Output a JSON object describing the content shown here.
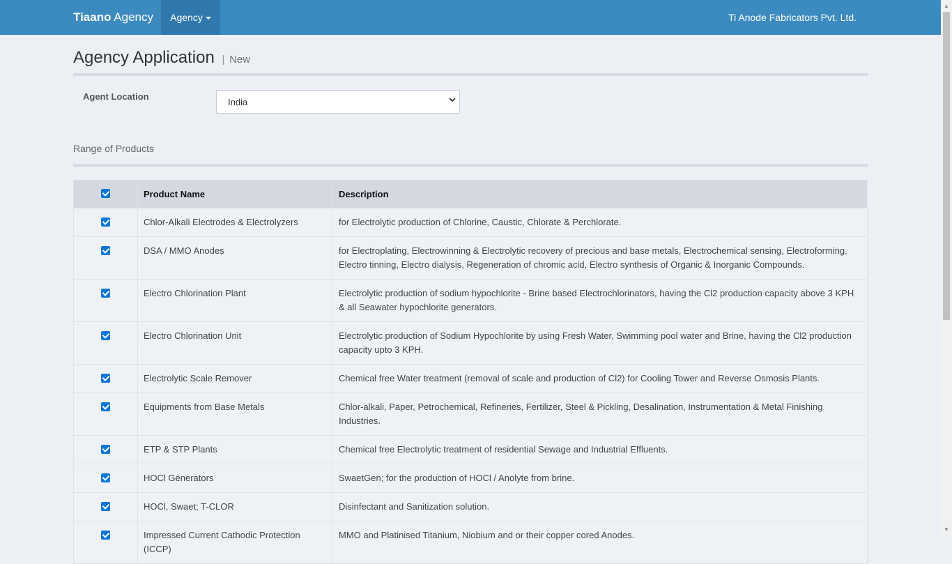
{
  "navbar": {
    "brand_bold": "Tiaano",
    "brand_rest": " Agency",
    "menu_label": "Agency",
    "company": "Ti Anode Fabricators Pvt. Ltd."
  },
  "page": {
    "title": "Agency Application",
    "separator": "|",
    "subtitle": "New"
  },
  "form": {
    "location_label": "Agent Location",
    "location_value": "India"
  },
  "section": {
    "title": "Range of Products"
  },
  "table": {
    "headers": [
      "Product Name",
      "Description"
    ],
    "rows": [
      {
        "name": "Chlor-Alkali Electrodes & Electrolyzers",
        "desc": "for Electrolytic production of Chlorine, Caustic, Chlorate & Perchlorate.",
        "checked": true
      },
      {
        "name": "DSA / MMO Anodes",
        "desc": "for Electroplating, Electrowinning & Electrolytic recovery of precious and base metals, Electrochemical sensing, Electroforming, Electro tinning, Electro dialysis, Regeneration of chromic acid, Electro synthesis of Organic & Inorganic Compounds.",
        "checked": true
      },
      {
        "name": "Electro Chlorination Plant",
        "desc": "Electrolytic production of sodium hypochlorite - Brine based Electrochlorinators, having the Cl2 production capacity above 3 KPH & all Seawater hypochlorite generators.",
        "checked": true
      },
      {
        "name": "Electro Chlorination Unit",
        "desc": "Electrolytic production of Sodium Hypochlorite by using Fresh Water, Swimming pool water and Brine, having the Cl2 production capacity upto 3 KPH.",
        "checked": true
      },
      {
        "name": "Electrolytic Scale Remover",
        "desc": "Chemical free Water treatment (removal of scale and production of Cl2) for Cooling Tower and Reverse Osmosis Plants.",
        "checked": true
      },
      {
        "name": "Equipments from Base Metals",
        "desc": "Chlor-alkali, Paper, Petrochemical, Refineries, Fertilizer, Steel & Pickling, Desalination, Instrumentation & Metal Finishing Industries.",
        "checked": true
      },
      {
        "name": "ETP & STP Plants",
        "desc": "Chemical free Electrolytic treatment of residential Sewage and Industrial Effluents.",
        "checked": true
      },
      {
        "name": "HOCl Generators",
        "desc": "SwaetGen; for the production of HOCl / Anolyte from brine.",
        "checked": true
      },
      {
        "name": "HOCl, Swaet; T-CLOR",
        "desc": "Disinfectant and Sanitization solution.",
        "checked": true
      },
      {
        "name": "Impressed Current Cathodic Protection (ICCP)",
        "desc": "MMO and Platinised Titanium, Niobium and or their copper cored Anodes.",
        "checked": true
      }
    ]
  },
  "colors": {
    "navbar": "#3b8ac0",
    "navbar_active": "#3079ae",
    "checkbox": "#0b76d8",
    "background": "#eceff4"
  },
  "icons": {
    "menu_caret": "caret-down-icon",
    "select_chevron": "chevron-down-icon",
    "checkbox": "checkbox-checked-icon"
  }
}
